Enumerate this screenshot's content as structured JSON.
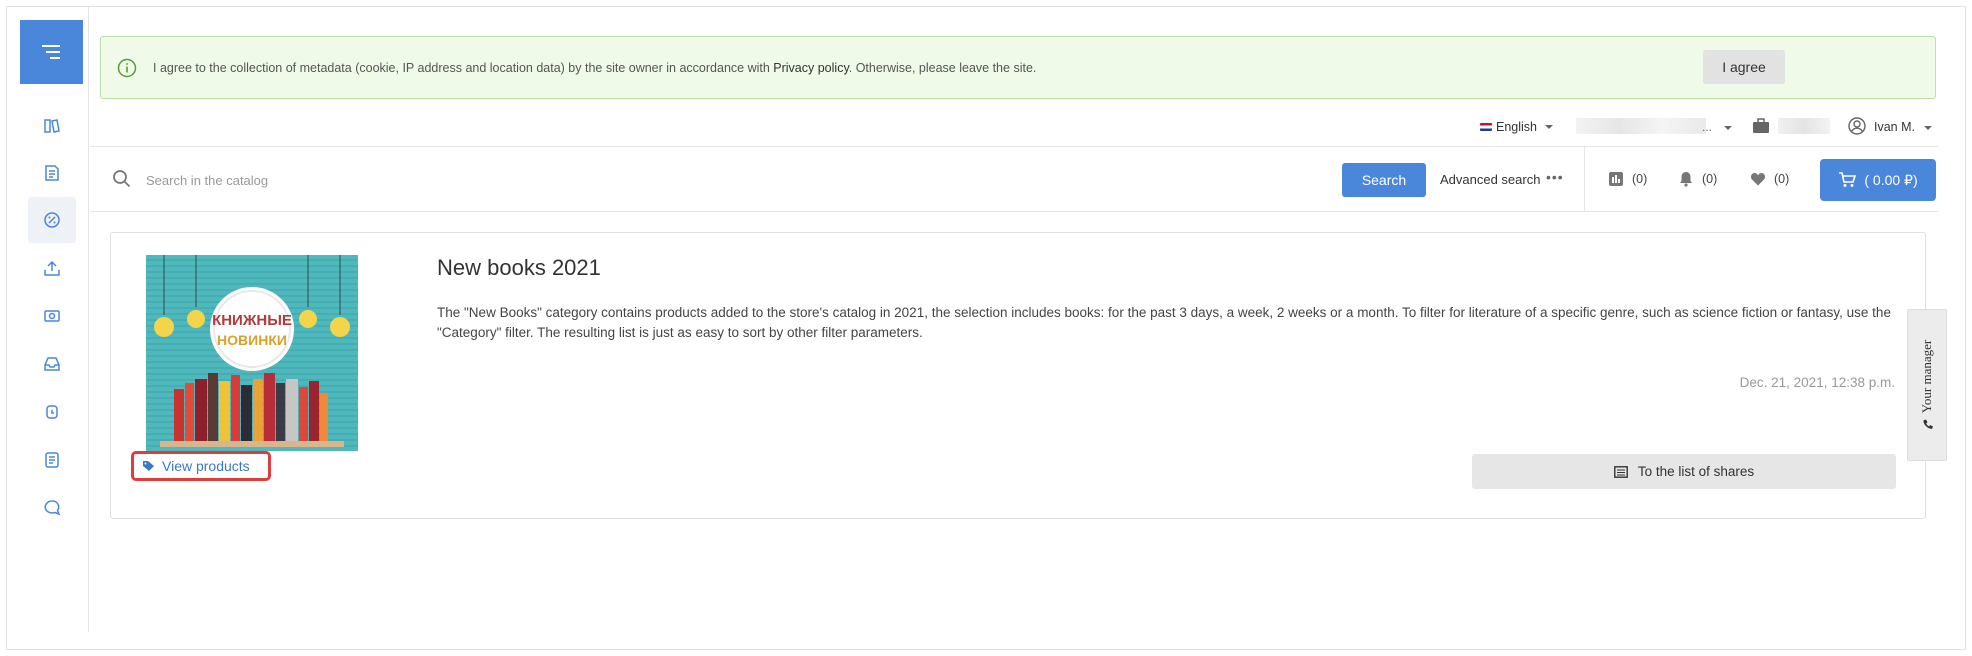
{
  "cookie": {
    "text_before": "I agree to the collection of metadata (cookie, IP address and location data) by the site owner in accordance with ",
    "privacy_link": "Privacy policy",
    "text_after": ". Otherwise, please leave the site.",
    "agree_label": "I agree"
  },
  "topbar": {
    "language": "English",
    "blur_suffix": "...",
    "user_name": "Ivan M."
  },
  "search": {
    "placeholder": "Search in the catalog",
    "button_label": "Search",
    "advanced_label": "Advanced search",
    "more_label": "•••"
  },
  "counters": {
    "compare": "(0)",
    "notifications": "(0)",
    "favorites": "(0)",
    "cart": "( 0.00 ₽)"
  },
  "share": {
    "title": "New books 2021",
    "description": "The \"New Books\" category contains products added to the store's catalog in 2021, the selection includes books: for the past 3 days, a week, 2 weeks or a month. To filter for literature of a specific genre, such as science fiction or fantasy, use the \"Category\" filter. The resulting list is just as easy to sort by other filter parameters.",
    "date": "Dec. 21, 2021, 12:38 p.m.",
    "view_products_label": "View products",
    "list_button_label": "To the list of shares",
    "cover_text_line1": "КНИЖНЫЕ",
    "cover_text_line2": "НОВИНКИ"
  },
  "manager_tab": {
    "label": "Your manager"
  },
  "colors": {
    "accent": "#4a86d9",
    "cookie_bg": "#f0fae8",
    "highlight": "#e23b3b"
  },
  "icons": {
    "sidebar": [
      "catalog-icon",
      "orders-icon",
      "discount-icon",
      "upload-icon",
      "payment-icon",
      "inbox-icon",
      "watch-icon",
      "documents-icon",
      "chat-icon"
    ]
  }
}
